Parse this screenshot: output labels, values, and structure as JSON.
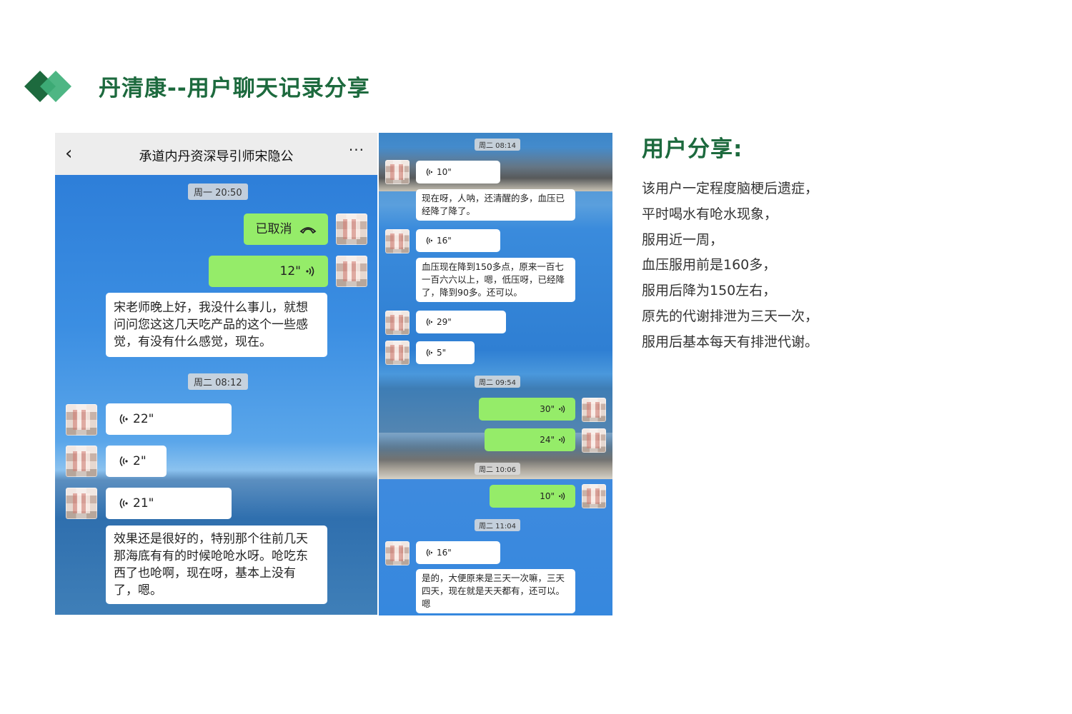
{
  "page": {
    "title": "丹清康--用户聊天记录分享",
    "brand_colors": {
      "dark_green": "#1d6a3e",
      "light_green": "#3fb07a"
    }
  },
  "left_chat": {
    "contact_name": "承道内丹资深导引师宋隐公",
    "back_icon": "chevron-left-icon",
    "more_icon": "more-dots-icon",
    "more_label": "···",
    "back_label": "‹",
    "time_1": "周一 20:50",
    "cancelled_call": "已取消",
    "sent_voice_1": "12\"",
    "msg_1": "宋老师晚上好，我没什么事儿，就想问问您这这几天吃产品的这个一些感觉，有没有什么感觉，现在。",
    "time_2": "周二 08:12",
    "voice_1": "22\"",
    "voice_2": "2\"",
    "voice_3": "21\"",
    "msg_2": "效果还是很好的，特别那个往前几天那海底有有的时候呛呛水呀。呛吃东西了也呛啊，现在呀，基本上没有了，嗯。"
  },
  "right_chat": {
    "time_1": "周二 08:14",
    "voice_1": "10\"",
    "msg_1": "现在呀，人呐，还清醒的多，血压已经降了降了。",
    "voice_2": "16\"",
    "msg_2": "血压现在降到150多点，原来一百七一百六六以上，嗯，低压呀，已经降了，降到90多。还可以。",
    "voice_3": "29\"",
    "voice_4": "5\"",
    "time_2": "周二 09:54",
    "sent_voice_1": "30\"",
    "sent_voice_2": "24\"",
    "time_3": "周二 10:06",
    "sent_voice_3": "10\"",
    "time_4": "周二 11:04",
    "voice_5": "16\"",
    "msg_3": "是的，大便原来是三天一次嘛，三天四天，现在就是天天都有，还可以。嗯"
  },
  "user_share": {
    "heading": "用户分享:",
    "lines": [
      "该用户一定程度脑梗后遗症，",
      "平时喝水有呛水现象，",
      "服用近一周，",
      "血压服用前是160多，",
      "服用后降为150左右，",
      "原先的代谢排泄为三天一次，",
      "服用后基本每天有排泄代谢。"
    ]
  }
}
